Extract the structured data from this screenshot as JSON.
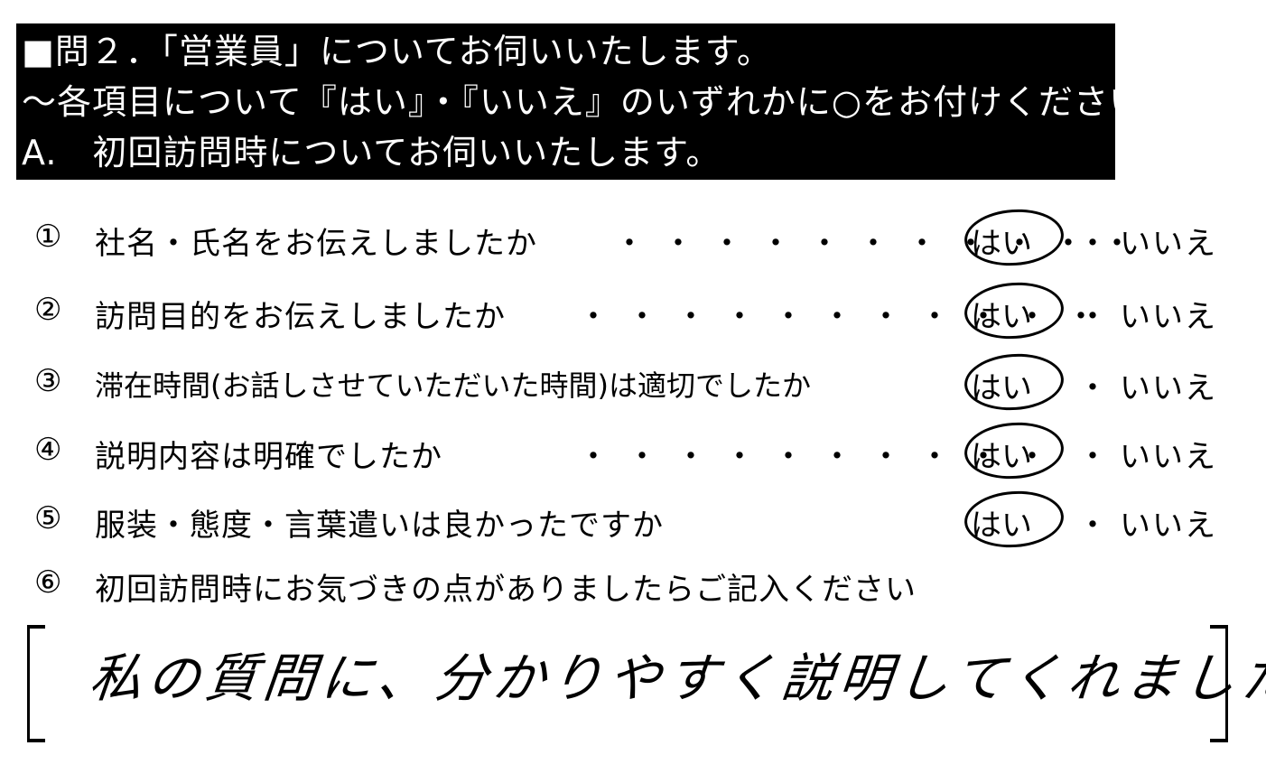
{
  "header": {
    "line1": "■問２．「営業員」についてお伺いいたします。",
    "line2": "～各項目について『はい』・『いいえ』のいずれかに○をお付けください。",
    "line3": "A.　初回訪問時についてお伺いいたします。"
  },
  "questions": [
    {
      "number": "①",
      "text": "社名・氏名をお伝えしましたか",
      "dots": "・・・・・・・・・・・",
      "yes": "はい",
      "separator": "・",
      "no": "いいえ",
      "selected": "はい"
    },
    {
      "number": "②",
      "text": "訪問目的をお伝えしましたか",
      "dots": "・・・・・・・・・・・",
      "yes": "はい",
      "separator": "・",
      "no": "いいえ",
      "selected": "はい"
    },
    {
      "number": "③",
      "text": "滞在時間(お話しさせていただいた時間)は適切でしたか",
      "dots": "",
      "yes": "はい",
      "separator": "・",
      "no": "いいえ",
      "selected": "はい"
    },
    {
      "number": "④",
      "text": "説明内容は明確でしたか",
      "dots": "・・・・・・・・・・",
      "yes": "はい",
      "separator": "・",
      "no": "いいえ",
      "selected": "はい"
    },
    {
      "number": "⑤",
      "text": "服装・態度・言葉遣いは良かったですか",
      "dots": "",
      "yes": "はい",
      "separator": "・",
      "no": "いいえ",
      "selected": "はい"
    }
  ],
  "comment_prompt": {
    "number": "⑥",
    "text": "初回訪問時にお気づきの点がありましたらご記入ください"
  },
  "handwritten_answer": "私の質問に、分かりやすく説明してくれました。"
}
